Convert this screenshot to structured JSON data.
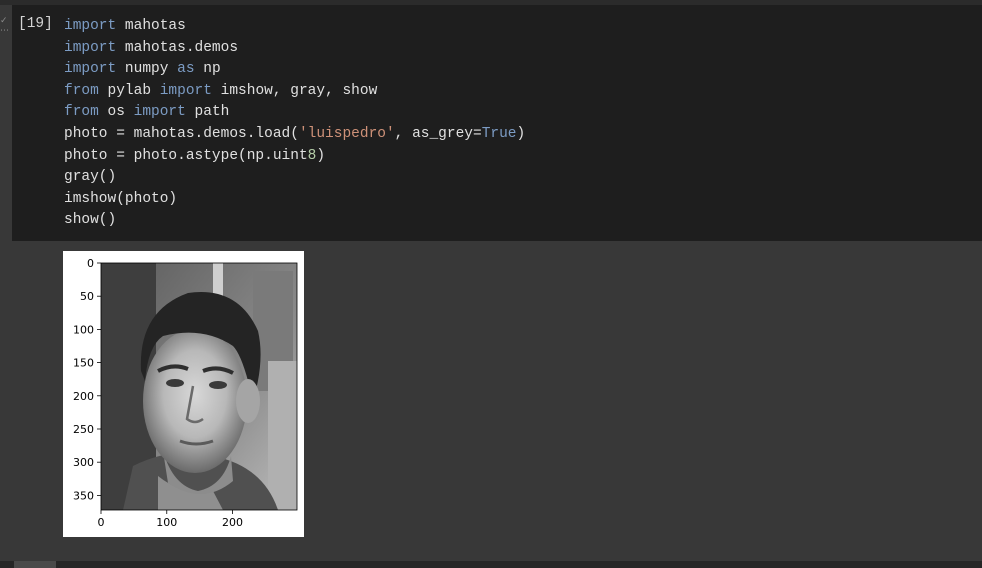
{
  "cell": {
    "execution_count": "[19]",
    "code_lines": [
      [
        {
          "t": "import",
          "c": "kw"
        },
        {
          "t": " mahotas"
        }
      ],
      [
        {
          "t": "import",
          "c": "kw"
        },
        {
          "t": " mahotas.demos"
        }
      ],
      [
        {
          "t": "import",
          "c": "kw"
        },
        {
          "t": " numpy "
        },
        {
          "t": "as",
          "c": "kw"
        },
        {
          "t": " np"
        }
      ],
      [
        {
          "t": "from",
          "c": "kw"
        },
        {
          "t": " pylab "
        },
        {
          "t": "import",
          "c": "kw"
        },
        {
          "t": " imshow, gray, show"
        }
      ],
      [
        {
          "t": "from",
          "c": "kw"
        },
        {
          "t": " os "
        },
        {
          "t": "import",
          "c": "kw"
        },
        {
          "t": " path"
        }
      ],
      [
        {
          "t": "photo = mahotas.demos.load("
        },
        {
          "t": "'luispedro'",
          "c": "str"
        },
        {
          "t": ", as_grey="
        },
        {
          "t": "True",
          "c": "bool"
        },
        {
          "t": ")"
        }
      ],
      [
        {
          "t": "photo = photo.astype(np.uint"
        },
        {
          "t": "8",
          "c": "num"
        },
        {
          "t": ")"
        }
      ],
      [
        {
          "t": "gray()"
        }
      ],
      [
        {
          "t": "imshow(photo)"
        }
      ],
      [
        {
          "t": "show()"
        }
      ]
    ]
  },
  "chart_data": {
    "type": "image",
    "x_ticks": [
      "0",
      "100",
      "200"
    ],
    "y_ticks": [
      "0",
      "50",
      "100",
      "150",
      "200",
      "250",
      "300",
      "350"
    ],
    "xlim": [
      0,
      298
    ],
    "ylim": [
      372,
      0
    ]
  }
}
